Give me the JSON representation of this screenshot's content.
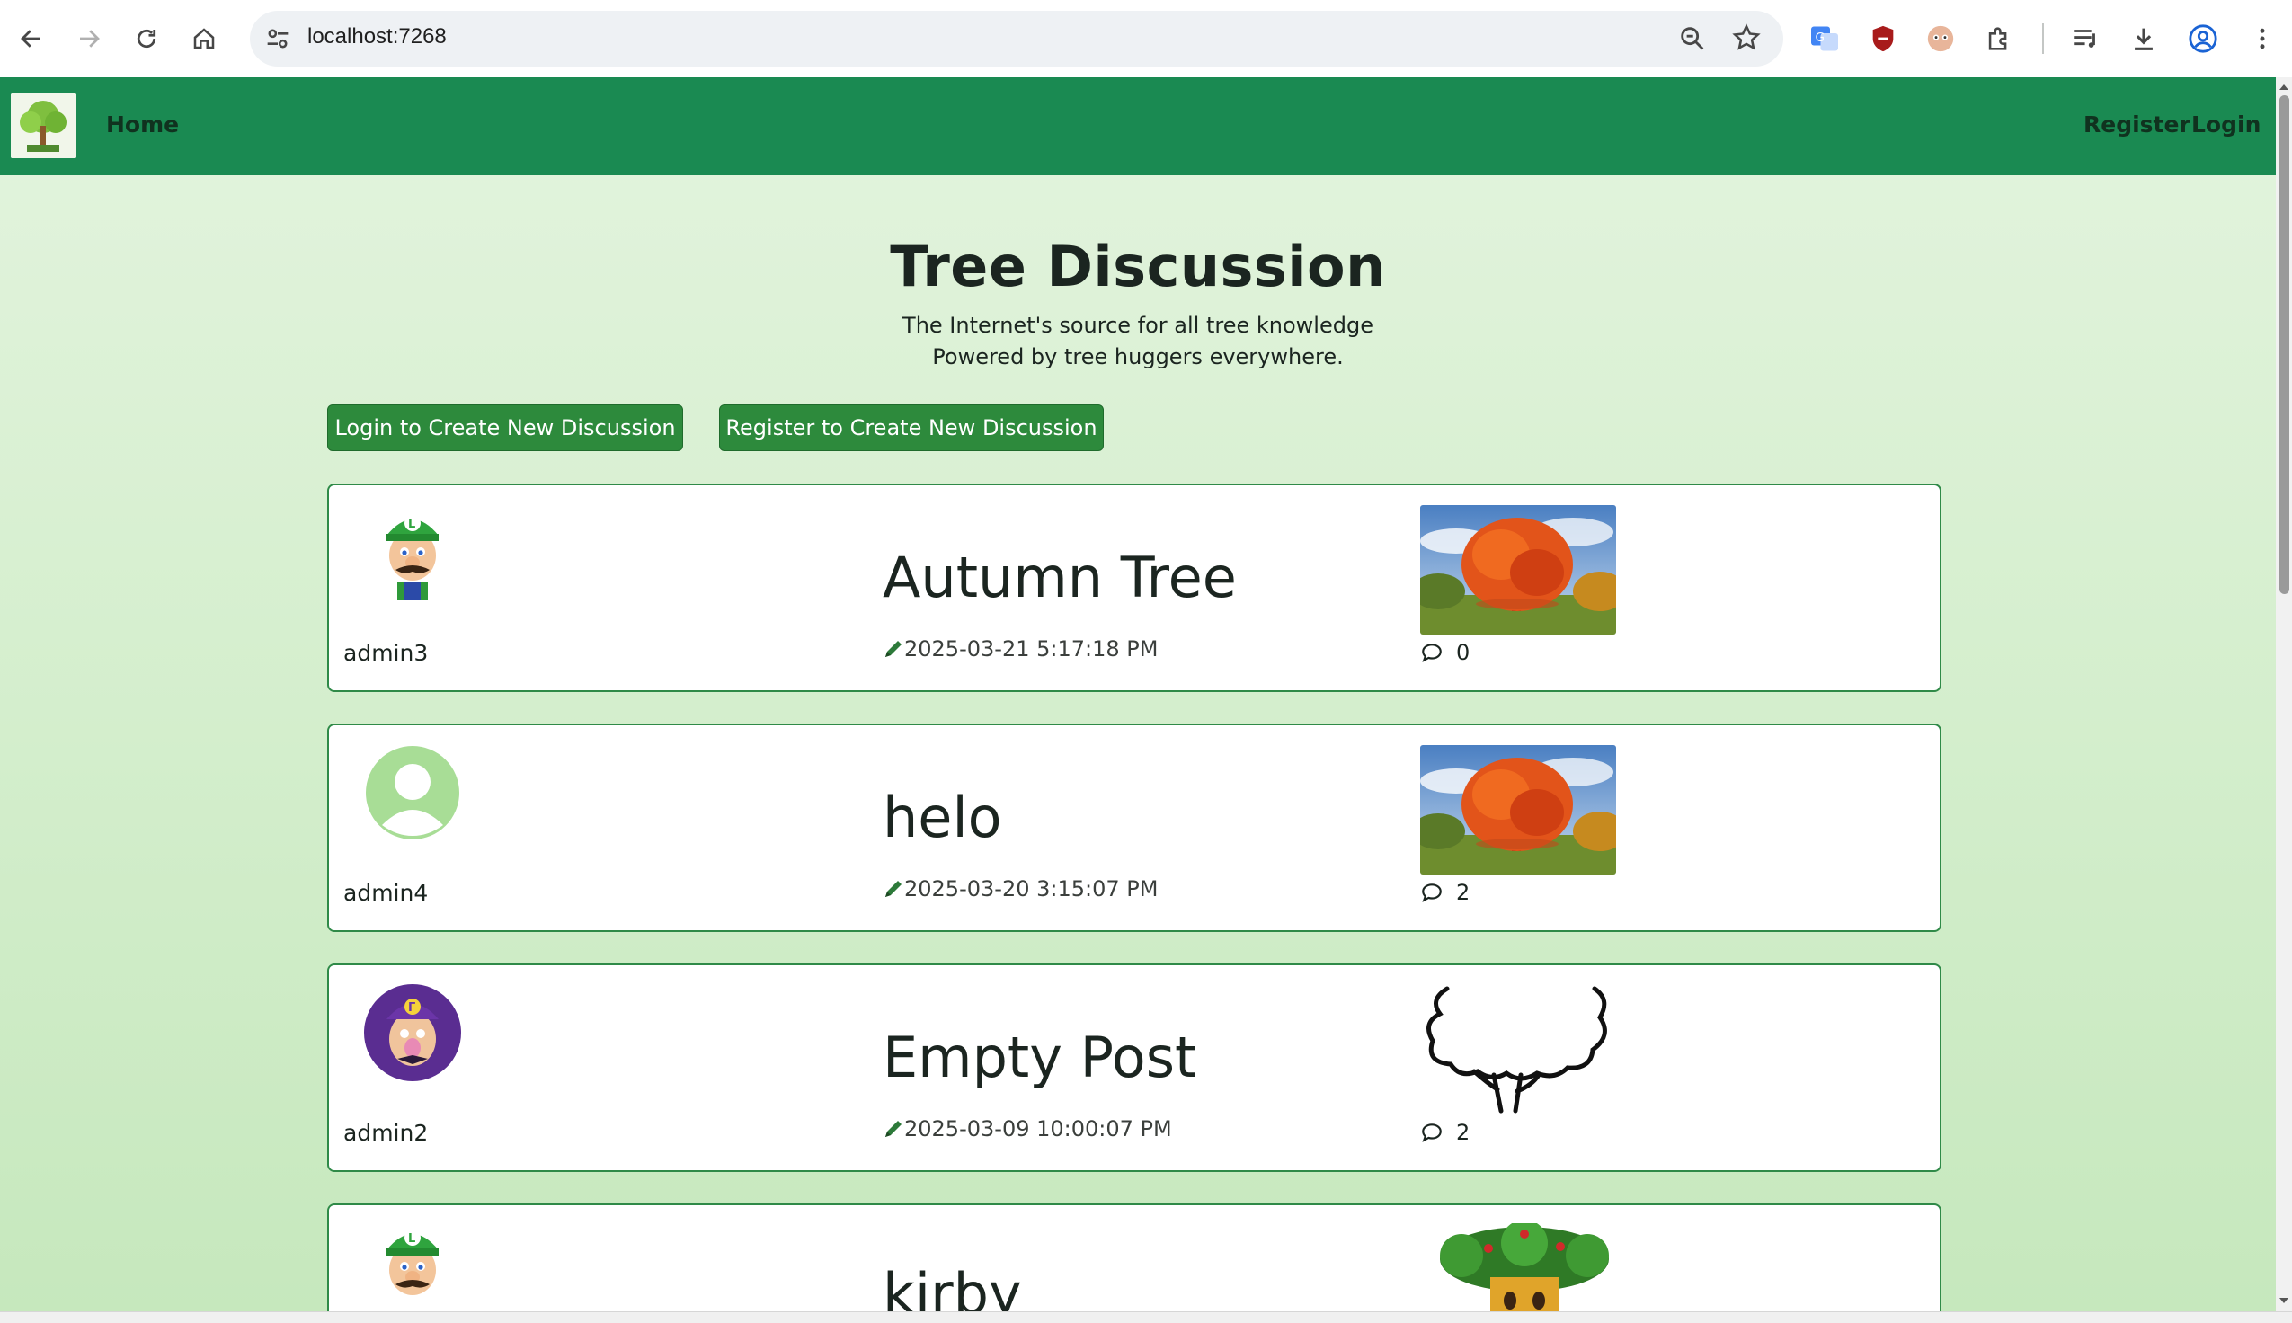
{
  "browser": {
    "url": "localhost:7268"
  },
  "navbar": {
    "home_label": "Home",
    "register_label": "Register",
    "login_label": "Login"
  },
  "hero": {
    "title": "Tree Discussion",
    "subtitle_line1": "The Internet's source for all tree knowledge",
    "subtitle_line2": "Powered by tree huggers everywhere."
  },
  "actions": {
    "login_create": "Login to Create New Discussion",
    "register_create": "Register to Create New Discussion"
  },
  "discussions": [
    {
      "author": "admin3",
      "title": "Autumn Tree",
      "date": "2025-03-21 5:17:18 PM",
      "comments": "0",
      "avatar_icon": "luigi-avatar-icon",
      "thumb_icon": "autumn-tree-image"
    },
    {
      "author": "admin4",
      "title": "helo",
      "date": "2025-03-20 3:15:07 PM",
      "comments": "2",
      "avatar_icon": "default-user-avatar-icon",
      "thumb_icon": "autumn-tree-image"
    },
    {
      "author": "admin2",
      "title": "Empty Post",
      "date": "2025-03-09 10:00:07 PM",
      "comments": "2",
      "avatar_icon": "waluigi-avatar-icon",
      "thumb_icon": "tree-outline-drawing"
    },
    {
      "author": "",
      "title": "kirby",
      "date": "",
      "comments": "",
      "avatar_icon": "luigi-avatar-icon",
      "thumb_icon": "whispy-woods-tree-image"
    }
  ],
  "colors": {
    "navbar": "#1a8a52",
    "button": "#2d8a3c",
    "card_border": "#2f8a48",
    "page_bg": "#d6efcf"
  }
}
